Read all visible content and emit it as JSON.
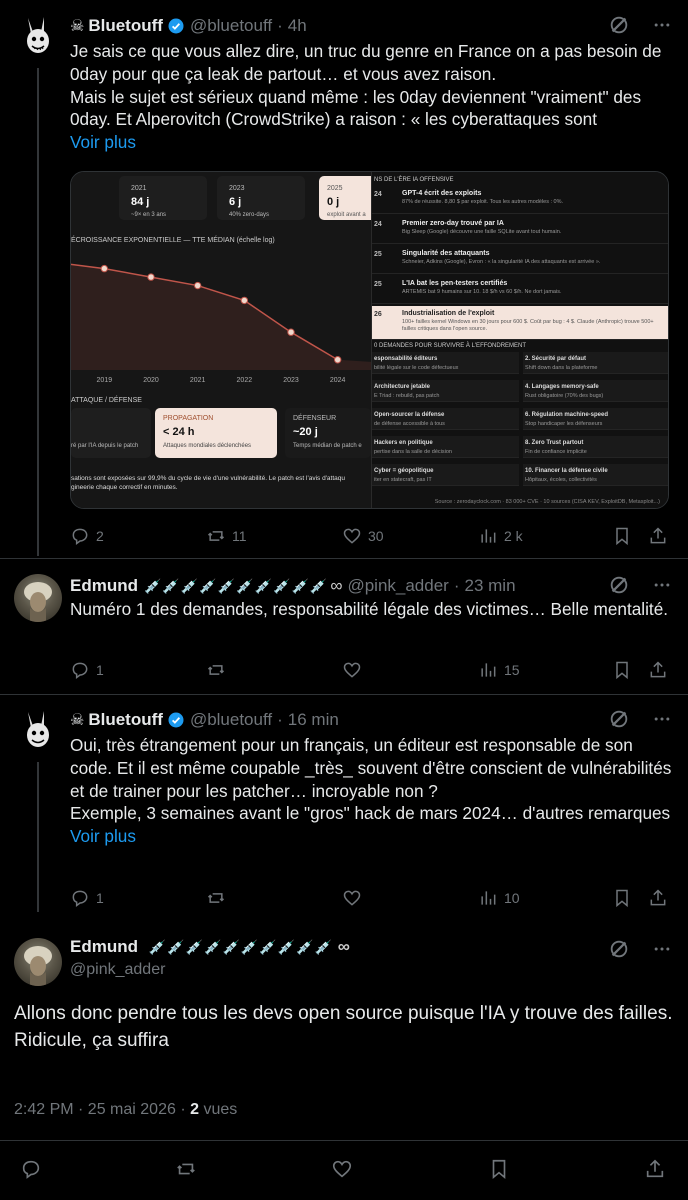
{
  "tweets": [
    {
      "name": "Bluetouff",
      "handle": "@bluetouff",
      "time": "4h",
      "text": "Je sais ce que vous allez dire, un truc du genre en France on a pas besoin de 0day pour que ça leak de partout… et vous avez raison.\nMais le sujet est sérieux quand même : les 0day deviennent \"vraiment\" des 0day. Et Alperovitch (CrowdStrike) a raison : « les cyberattaques sont",
      "more": "Voir plus",
      "replies": "2",
      "reposts": "11",
      "likes": "30",
      "views": "2 k"
    },
    {
      "name": "Edmund",
      "handle": "@pink_adder",
      "time": "23 min",
      "text": "Numéro 1 des demandes, responsabilité légale des victimes… Belle mentalité.",
      "replies": "1",
      "views": "15"
    },
    {
      "name": "Bluetouff",
      "handle": "@bluetouff",
      "time": "16 min",
      "text": "Oui, très étrangement pour un français, un éditeur est responsable de son code. Et il est même coupable _très_ souvent d'être conscient de vulnérabilités et de trainer pour les patcher… incroyable non ?\nExemple, 3 semaines avant le \"gros\" hack de mars 2024… d'autres remarques",
      "more": "Voir plus",
      "replies": "1",
      "views": "10"
    }
  ],
  "focus": {
    "name": "Edmund",
    "handle": "@pink_adder",
    "text": "Allons donc pendre tous les devs open source puisque l'IA y trouve des failles.\nRidicule, ça suffira",
    "datetime": "2:42 PM · 25 mai 2026 · ",
    "views_count": "2",
    "views_label": " vues"
  },
  "dot": "·",
  "infinity": "∞",
  "media": {
    "stats": [
      {
        "year": "2021",
        "value": "84 j",
        "sub": "~9× en 3 ans"
      },
      {
        "year": "2023",
        "value": "6 j",
        "sub": "40% zero-days"
      },
      {
        "year": "2025",
        "value": "0 j",
        "sub": "exploit avant a"
      }
    ],
    "chart_title": "ÉCROISSANCE EXPONENTIELLE — TTE MÉDIAN (échelle log)",
    "chart_data": {
      "type": "line",
      "x": [
        "2019",
        "2020",
        "2021",
        "2022",
        "2023",
        "2024"
      ],
      "log_scale": true
    },
    "attack_title": "ATTAQUE / DÉFENSE",
    "attack_left": "ré par l'IA depuis le patch",
    "propagation": {
      "label": "PROPAGATION",
      "value": "< 24 h",
      "sub": "Attaques mondiales déclenchées"
    },
    "defender": {
      "label": "DÉFENSEUR",
      "value": "~20 j",
      "sub": "Temps médian de patch e"
    },
    "footnote": "sations sont exposées sur 99,9% du cycle de vie d'une vulnérabilité. Le patch est l'avis d'attaqu\ngineerie chaque correctif en minutes.",
    "timeline_title": "NS DE L'ÈRE IA OFFENSIVE",
    "timeline": [
      {
        "yr": "24",
        "title": "GPT-4 écrit des exploits",
        "sub": "87% de réussite. 8,80 $ par exploit. Tous les autres modèles : 0%."
      },
      {
        "yr": "24",
        "title": "Premier zero-day trouvé par IA",
        "sub": "Big Sleep (Google) découvre une faille SQLite avant tout humain."
      },
      {
        "yr": "25",
        "title": "Singularité des attaquants",
        "sub": "Schneier, Adkins (Google), Evron : « la singularité IA des attaquants est arrivée »."
      },
      {
        "yr": "25",
        "title": "L'IA bat les pen-testers certifiés",
        "sub": "ARTEMIS bat 9 humains sur 10. 18 $/h vs 60 $/h. Ne dort jamais."
      },
      {
        "yr": "26",
        "title": "Industrialisation de l'exploit",
        "sub": "100+ failles kernel Windows en 30 jours pour 600 $. Coût par bug : 4 $. Claude (Anthropic) trouve 500+ failles critiques dans l'open source."
      }
    ],
    "demands_title": "0 DEMANDES POUR SURVIVRE À L'EFFONDREMENT",
    "demands": [
      {
        "t": "esponsabilité éditeurs",
        "s": "bilité légale sur le code défectueux"
      },
      {
        "t": "2. Sécurité par défaut",
        "s": "Shift down dans la plateforme"
      },
      {
        "t": "Architecture jetable",
        "s": "E Triad : rebuild, pas patch"
      },
      {
        "t": "4. Langages memory-safe",
        "s": "Rust obligatoire (70% des bugs)"
      },
      {
        "t": "Open-sourcer la défense",
        "s": "de défense accessible à tous"
      },
      {
        "t": "6. Régulation machine-speed",
        "s": "Stop handicaper les défenseurs"
      },
      {
        "t": "Hackers en politique",
        "s": "pertise dans la salle de décision"
      },
      {
        "t": "8. Zero Trust partout",
        "s": "Fin de confiance implicite"
      },
      {
        "t": "Cyber = géopolitique",
        "s": "iter en statecraft, pas IT"
      },
      {
        "t": "10. Financer la défense civile",
        "s": "Hôpitaux, écoles, collectivités"
      }
    ],
    "source": "Source : zerodayclock.com · 83 000+ CVE · 10 sources (CISA KEV, ExploitDB, Metasploit...)"
  },
  "colors": {
    "accent": "#1d9bf0",
    "muted": "#71767b",
    "bg": "#000000",
    "chart_line": "#c0554a"
  }
}
